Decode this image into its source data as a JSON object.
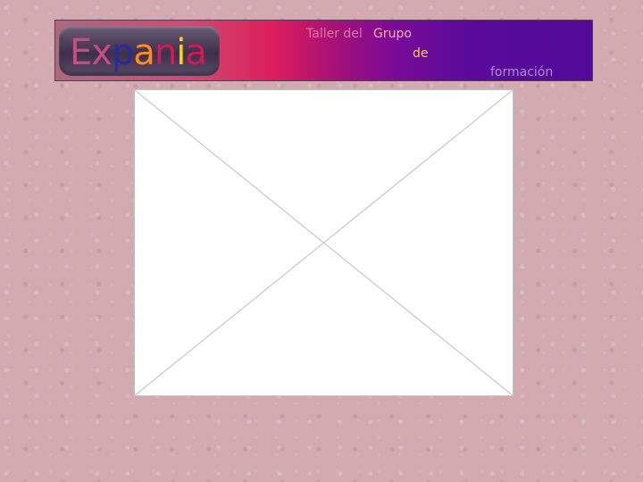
{
  "header": {
    "logo": {
      "letters": [
        {
          "char": "E",
          "color": "#c94b86"
        },
        {
          "char": "x",
          "color": "#c94b86"
        },
        {
          "char": "p",
          "color": "#2a2a9a"
        },
        {
          "char": "a",
          "color": "#ff8a1a"
        },
        {
          "char": "n",
          "color": "#d01a58"
        },
        {
          "char": "i",
          "color": "#ffd400"
        },
        {
          "char": "a",
          "color": "#d01a58"
        }
      ]
    },
    "title_taller": "Taller del",
    "title_grupo": "Grupo",
    "title_de": "de",
    "title_formacion": "formación"
  },
  "content": {
    "image": {
      "icon": "missing-image-placeholder"
    }
  }
}
